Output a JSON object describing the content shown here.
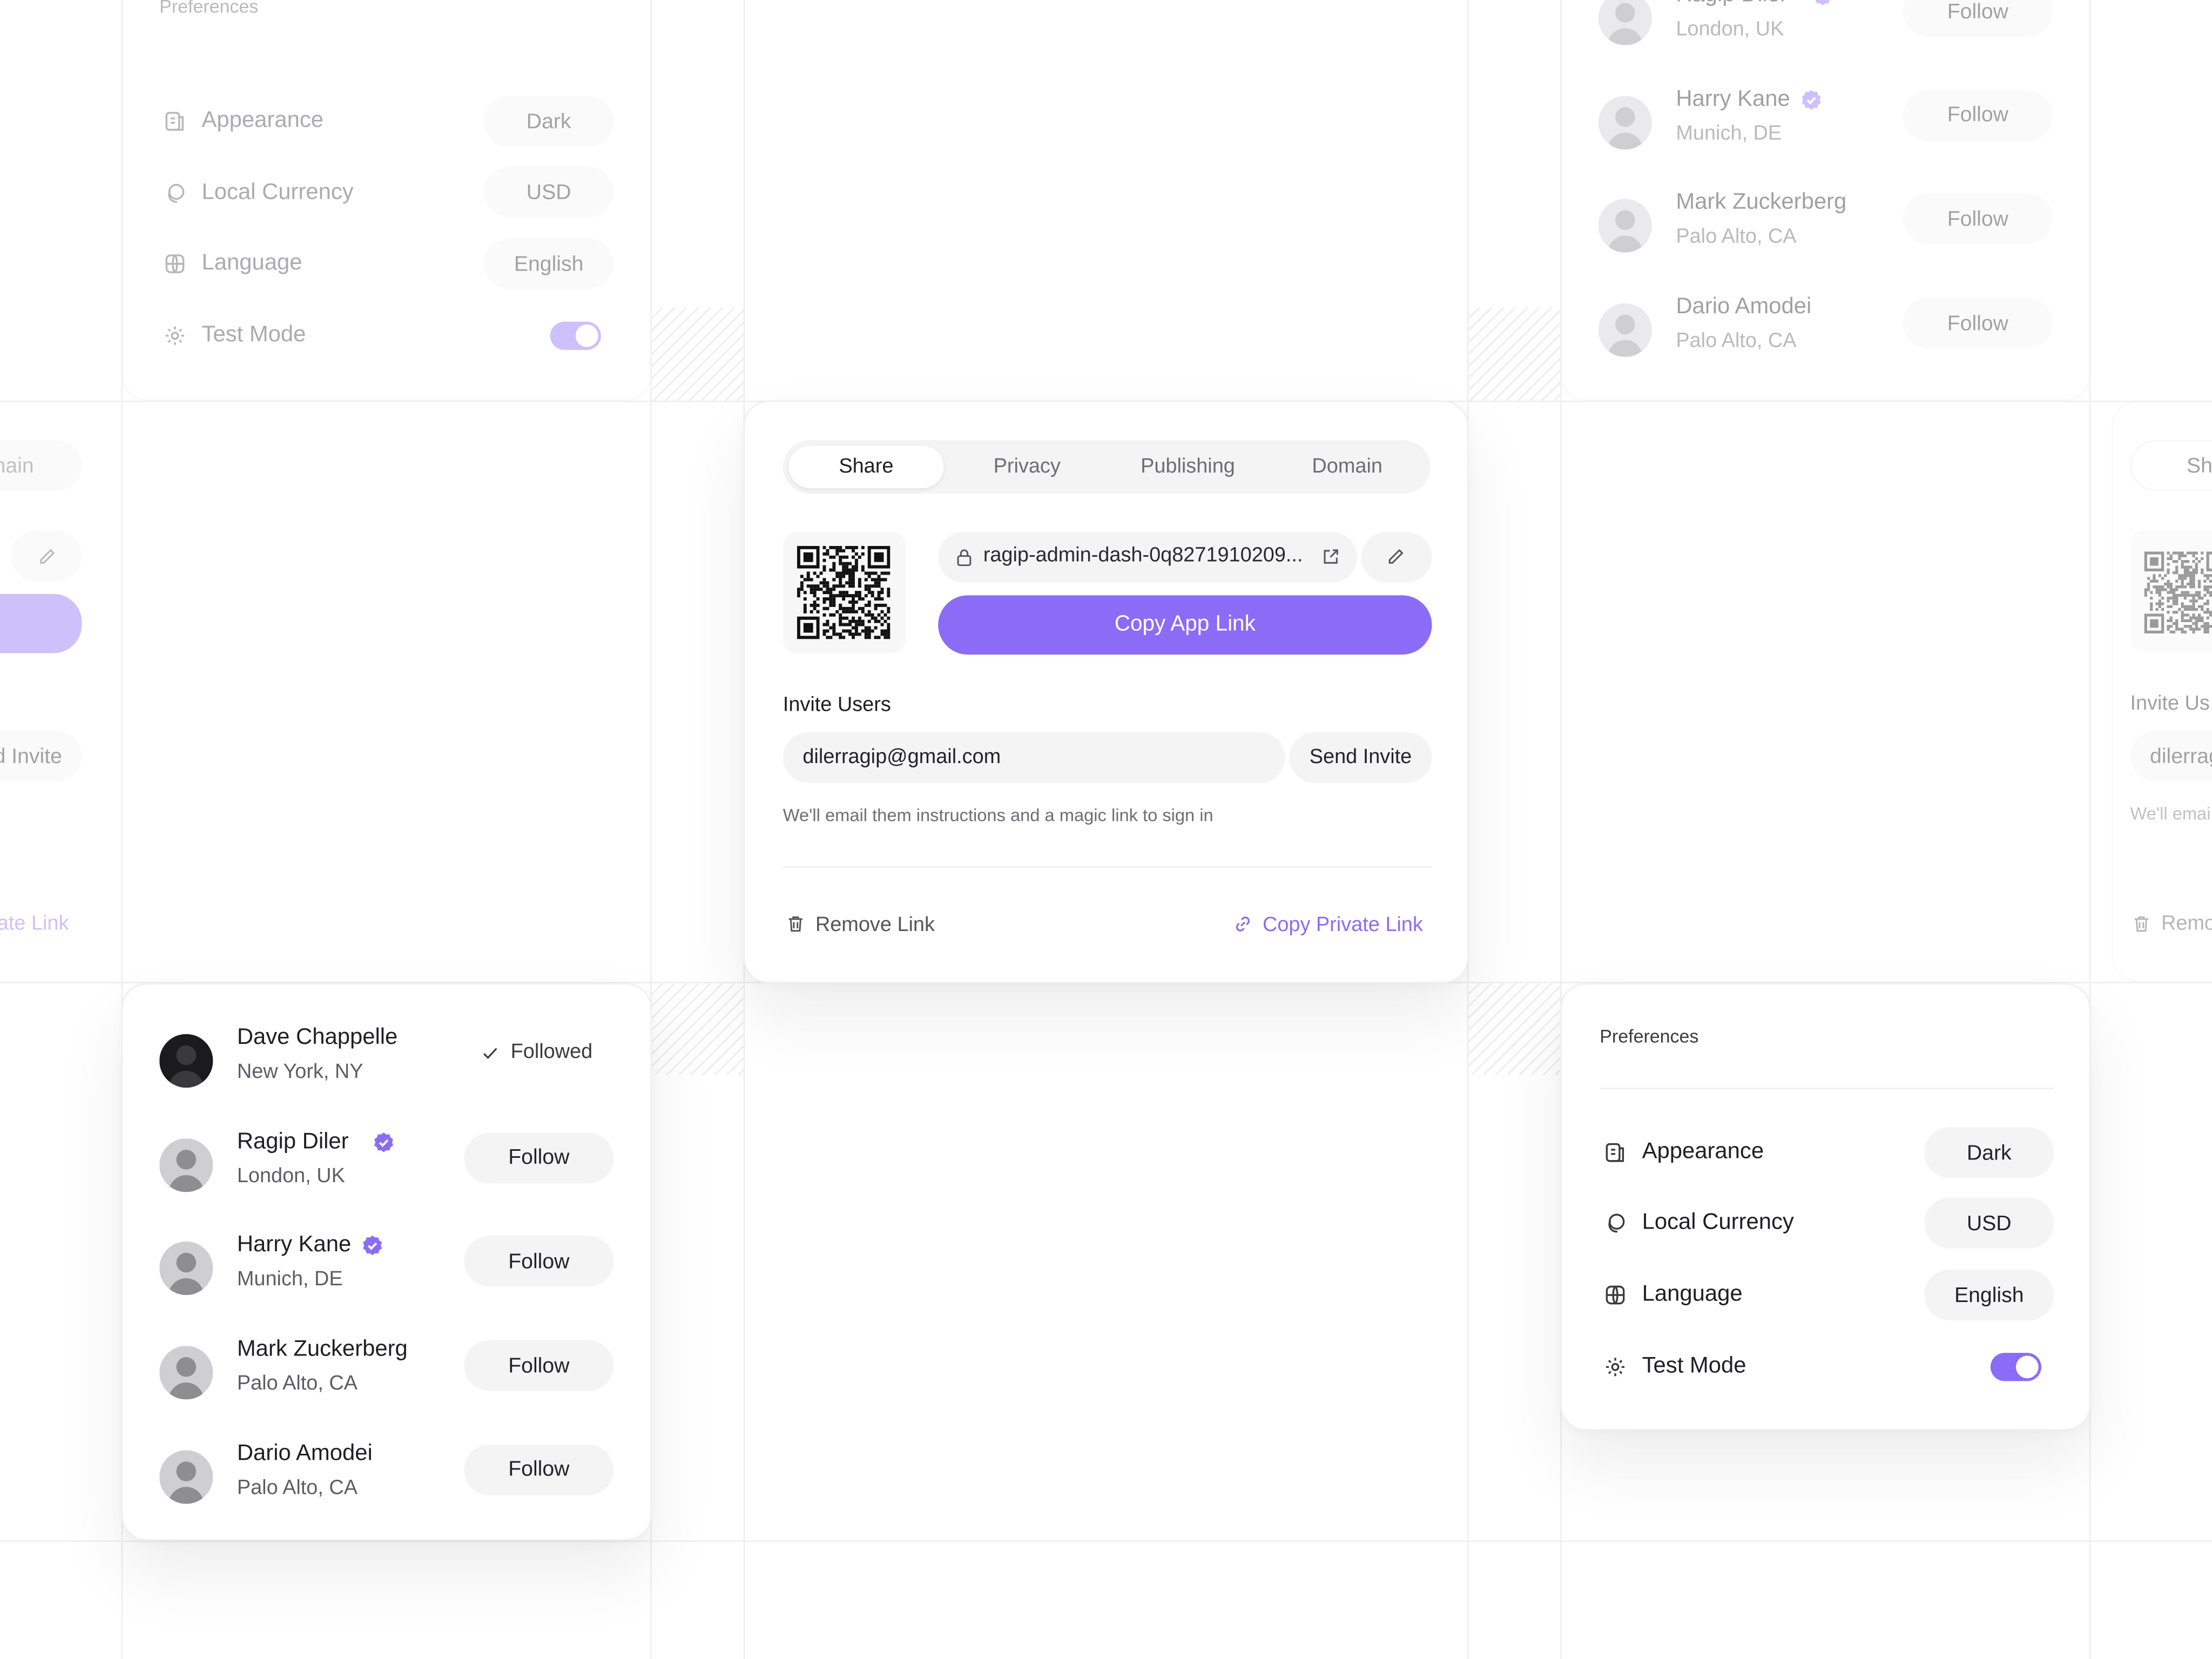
{
  "share": {
    "tabs": [
      "Share",
      "Privacy",
      "Publishing",
      "Domain"
    ],
    "active_tab": "Share",
    "link": "ragip-admin-dash-0q8271910209...",
    "copy_app_link": "Copy App Link",
    "invite_title": "Invite Users",
    "invite_email": "dilerragip@gmail.com",
    "send_invite": "Send Invite",
    "helper": "We'll email them instructions and a magic link to sign in",
    "remove_link": "Remove Link",
    "copy_private_link": "Copy Private Link"
  },
  "people": {
    "followed_label": "Followed",
    "follow_label": "Follow",
    "items": [
      {
        "name": "Dave Chappelle",
        "location": "New York, NY",
        "verified": false,
        "followed": true
      },
      {
        "name": "Ragip Diler",
        "location": "London, UK",
        "verified": true,
        "followed": false
      },
      {
        "name": "Harry Kane",
        "location": "Munich, DE",
        "verified": true,
        "followed": false
      },
      {
        "name": "Mark Zuckerberg",
        "location": "Palo Alto, CA",
        "verified": false,
        "followed": false
      },
      {
        "name": "Dario Amodei",
        "location": "Palo Alto, CA",
        "verified": false,
        "followed": false
      }
    ]
  },
  "preferences": {
    "title": "Preferences",
    "items": [
      {
        "label": "Appearance",
        "value": "Dark",
        "icon": "palette-icon"
      },
      {
        "label": "Local Currency",
        "value": "USD",
        "icon": "currency-icon"
      },
      {
        "label": "Language",
        "value": "English",
        "icon": "globe-icon"
      },
      {
        "label": "Test Mode",
        "value": "",
        "icon": "gear-icon",
        "toggle": true,
        "toggle_on": true
      }
    ]
  },
  "ghost": {
    "domain_fragment": "nain",
    "invite_fragment": "d Invite",
    "private_fragment": "ate Link",
    "tab_fragment": "Sh",
    "invite_users_fragment": "Invite Us",
    "email_fragment": "dilerrag",
    "helper_fragment": "We'll emai",
    "remove_fragment": "Remo"
  },
  "colors": {
    "accent": "#8b6cf6",
    "pill": "#f4f4f5",
    "text": "#1f1f23",
    "muted": "#6d6d73"
  }
}
